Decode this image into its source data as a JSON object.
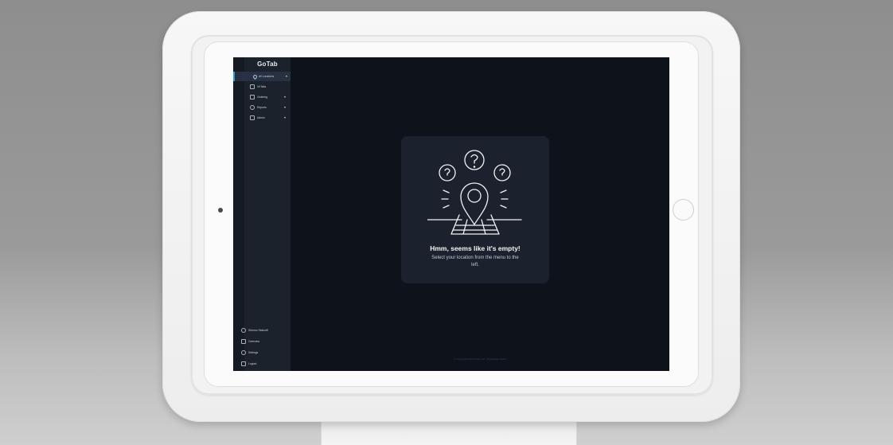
{
  "brand": {
    "logo_text": "GoTab"
  },
  "sidebar": {
    "items": [
      {
        "label": "All Locations",
        "icon": "location-pin-icon",
        "active": true,
        "has_caret": true
      },
      {
        "label": "VirTabs",
        "icon": "grid-icon",
        "active": false,
        "has_caret": false
      },
      {
        "label": "Ordering",
        "icon": "menu-book-icon",
        "active": false,
        "has_caret": true
      },
      {
        "label": "Reports",
        "icon": "pie-chart-icon",
        "active": false,
        "has_caret": true
      },
      {
        "label": "Admin",
        "icon": "bag-icon",
        "active": false,
        "has_caret": true
      }
    ],
    "bottom_items": [
      {
        "label": "Shlomo Stoltzoff",
        "icon": "user-avatar-icon"
      },
      {
        "label": "Overview",
        "icon": "bar-chart-icon"
      },
      {
        "label": "Settings",
        "icon": "gear-icon"
      },
      {
        "label": "Logout",
        "icon": "logout-icon"
      }
    ]
  },
  "empty_state": {
    "title": "Hmm, seems like it's empty!",
    "message": "Select your location from the menu to the left.",
    "illustration": "location-pin-question-icon"
  },
  "footer": {
    "text": "© Copyright 2019 GoTab, Inc. | Feedback | About"
  },
  "colors": {
    "screen_bg": "#0e121a",
    "sidebar_bg": "#1c222c",
    "card_bg": "#1c222d",
    "accent": "#2f9ad6",
    "bezel": "#f4f4f4"
  }
}
